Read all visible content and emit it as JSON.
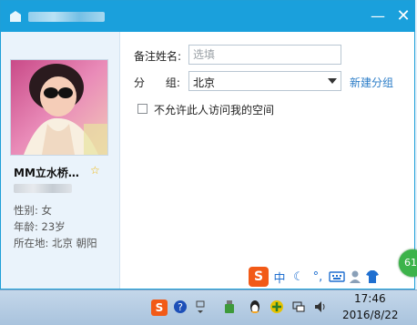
{
  "window": {
    "minimize_symbol": "—",
    "close_symbol": "✕"
  },
  "profile": {
    "nickname": "MM立水桥…",
    "star_symbol": "☆",
    "gender": "性别: 女",
    "age": "年龄: 23岁",
    "location": "所在地: 北京  朝阳"
  },
  "form": {
    "remark_label": "备注姓名:",
    "remark_placeholder": "选填",
    "remark_value": "",
    "group_label": "分      组:",
    "group_value": "北京",
    "new_group_link": "新建分组",
    "privacy_checkbox_label": "不允许此人访问我的空间",
    "privacy_checked": false
  },
  "ime_toolbar": {
    "logo": "S",
    "mode": "中",
    "moon": "☾",
    "punct": "°,",
    "badge_count": "61"
  },
  "taskbar": {
    "time": "17:46",
    "date": "2016/8/22"
  },
  "colors": {
    "titlebar": "#1aa0dc",
    "link": "#2a7cc7",
    "sogou": "#f25a17",
    "badge": "#3cb34a"
  }
}
